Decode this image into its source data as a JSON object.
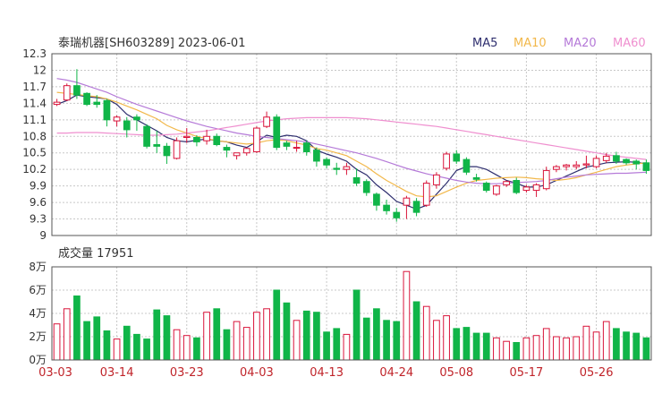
{
  "chart_data": {
    "type": "candlestick",
    "title": "泰瑞机器[SH603289] 2023-06-01",
    "legend": [
      {
        "label": "MA5",
        "color": "#2e2e6e"
      },
      {
        "label": "MA10",
        "color": "#f2b84b"
      },
      {
        "label": "MA20",
        "color": "#b57ad8"
      },
      {
        "label": "MA60",
        "color": "#ef8fcf"
      }
    ],
    "colors": {
      "up": "#d9143a",
      "down": "#10b548",
      "volume_up": "#d9143a",
      "volume_down": "#10b548"
    },
    "price_axis": {
      "ticks": [
        "12.3",
        "12",
        "11.7",
        "11.4",
        "11.1",
        "10.8",
        "10.5",
        "10.2",
        "9.9",
        "9.6",
        "9.3",
        "9"
      ],
      "ylim": [
        9,
        12.3
      ]
    },
    "x_labels": [
      "03-03",
      "03-14",
      "03-23",
      "04-03",
      "04-13",
      "04-24",
      "05-08",
      "05-17",
      "05-26"
    ],
    "x_label_index": [
      0,
      6,
      13,
      20,
      27,
      34,
      40,
      47,
      54
    ],
    "candles": [
      [
        11.38,
        11.48,
        11.35,
        11.42
      ],
      [
        11.46,
        11.76,
        11.44,
        11.72
      ],
      [
        11.72,
        12.02,
        11.48,
        11.55
      ],
      [
        11.58,
        11.6,
        11.35,
        11.38
      ],
      [
        11.42,
        11.55,
        11.32,
        11.38
      ],
      [
        11.45,
        11.48,
        10.98,
        11.1
      ],
      [
        11.08,
        11.18,
        10.98,
        11.15
      ],
      [
        11.08,
        11.15,
        10.78,
        10.92
      ],
      [
        11.15,
        11.2,
        10.9,
        11.1
      ],
      [
        10.98,
        11.02,
        10.58,
        10.62
      ],
      [
        10.65,
        10.9,
        10.5,
        10.62
      ],
      [
        10.62,
        10.68,
        10.3,
        10.45
      ],
      [
        10.4,
        10.78,
        10.38,
        10.72
      ],
      [
        10.78,
        10.95,
        10.68,
        10.8
      ],
      [
        10.78,
        10.82,
        10.62,
        10.7
      ],
      [
        10.72,
        10.92,
        10.65,
        10.8
      ],
      [
        10.8,
        10.85,
        10.62,
        10.65
      ],
      [
        10.6,
        10.65,
        10.42,
        10.55
      ],
      [
        10.45,
        10.5,
        10.38,
        10.5
      ],
      [
        10.5,
        10.6,
        10.45,
        10.58
      ],
      [
        10.52,
        10.98,
        10.5,
        10.95
      ],
      [
        10.98,
        11.25,
        10.95,
        11.15
      ],
      [
        11.15,
        11.2,
        10.55,
        10.6
      ],
      [
        10.68,
        10.72,
        10.55,
        10.62
      ],
      [
        10.6,
        10.72,
        10.52,
        10.6
      ],
      [
        10.68,
        10.72,
        10.45,
        10.52
      ],
      [
        10.55,
        10.6,
        10.25,
        10.35
      ],
      [
        10.38,
        10.42,
        10.22,
        10.28
      ],
      [
        10.22,
        10.32,
        10.1,
        10.2
      ],
      [
        10.2,
        10.32,
        10.1,
        10.25
      ],
      [
        10.05,
        10.22,
        9.9,
        9.95
      ],
      [
        9.98,
        10.02,
        9.72,
        9.78
      ],
      [
        9.75,
        9.78,
        9.45,
        9.55
      ],
      [
        9.55,
        9.65,
        9.38,
        9.45
      ],
      [
        9.42,
        9.5,
        9.25,
        9.32
      ],
      [
        9.55,
        9.72,
        9.3,
        9.68
      ],
      [
        9.62,
        9.68,
        9.35,
        9.42
      ],
      [
        9.55,
        10.0,
        9.52,
        9.95
      ],
      [
        9.92,
        10.15,
        9.85,
        10.1
      ],
      [
        10.22,
        10.52,
        10.18,
        10.48
      ],
      [
        10.48,
        10.55,
        10.3,
        10.35
      ],
      [
        10.38,
        10.42,
        10.1,
        10.15
      ],
      [
        10.05,
        10.12,
        9.98,
        10.02
      ],
      [
        9.95,
        9.98,
        9.78,
        9.82
      ],
      [
        9.75,
        9.92,
        9.72,
        9.9
      ],
      [
        9.92,
        10.0,
        9.88,
        9.98
      ],
      [
        10.0,
        10.05,
        9.75,
        9.78
      ],
      [
        9.82,
        9.92,
        9.78,
        9.88
      ],
      [
        9.82,
        9.95,
        9.7,
        9.92
      ],
      [
        9.85,
        10.25,
        9.82,
        10.18
      ],
      [
        10.2,
        10.28,
        10.15,
        10.25
      ],
      [
        10.25,
        10.3,
        10.18,
        10.28
      ],
      [
        10.25,
        10.35,
        10.2,
        10.28
      ],
      [
        10.28,
        10.45,
        10.22,
        10.3
      ],
      [
        10.25,
        10.45,
        10.22,
        10.4
      ],
      [
        10.36,
        10.5,
        10.32,
        10.44
      ],
      [
        10.45,
        10.52,
        10.3,
        10.35
      ],
      [
        10.38,
        10.4,
        10.28,
        10.32
      ],
      [
        10.35,
        10.38,
        10.2,
        10.3
      ],
      [
        10.32,
        10.38,
        10.12,
        10.18
      ]
    ],
    "moving_averages": [
      {
        "name": "MA5",
        "values": [
          11.38,
          11.45,
          11.55,
          11.52,
          11.5,
          11.48,
          11.38,
          11.2,
          11.1,
          11.0,
          10.9,
          10.78,
          10.72,
          10.7,
          10.73,
          10.75,
          10.72,
          10.7,
          10.64,
          10.6,
          10.7,
          10.82,
          10.78,
          10.82,
          10.8,
          10.72,
          10.55,
          10.48,
          10.42,
          10.35,
          10.2,
          10.1,
          9.92,
          9.78,
          9.62,
          9.55,
          9.48,
          9.55,
          9.75,
          9.95,
          10.18,
          10.25,
          10.25,
          10.2,
          10.1,
          10.0,
          9.95,
          9.88,
          9.88,
          9.92,
          10.0,
          10.08,
          10.16,
          10.24,
          10.28,
          10.32,
          10.33,
          10.34,
          10.33,
          10.3
        ]
      },
      {
        "name": "MA10",
        "values": [
          11.6,
          11.58,
          11.56,
          11.54,
          11.52,
          11.48,
          11.42,
          11.35,
          11.28,
          11.2,
          11.12,
          11.0,
          10.92,
          10.86,
          10.8,
          10.76,
          10.72,
          10.7,
          10.68,
          10.66,
          10.68,
          10.72,
          10.74,
          10.72,
          10.68,
          10.64,
          10.58,
          10.55,
          10.5,
          10.45,
          10.35,
          10.25,
          10.12,
          10.0,
          9.9,
          9.8,
          9.72,
          9.7,
          9.72,
          9.8,
          9.88,
          9.95,
          10.0,
          10.02,
          10.04,
          10.05,
          10.06,
          10.05,
          10.03,
          10.02,
          10.0,
          10.02,
          10.05,
          10.1,
          10.15,
          10.2,
          10.25,
          10.28,
          10.3,
          10.32
        ]
      },
      {
        "name": "MA20",
        "values": [
          11.85,
          11.82,
          11.78,
          11.72,
          11.66,
          11.6,
          11.52,
          11.45,
          11.38,
          11.32,
          11.26,
          11.2,
          11.14,
          11.08,
          11.03,
          10.98,
          10.94,
          10.9,
          10.86,
          10.83,
          10.8,
          10.78,
          10.76,
          10.74,
          10.72,
          10.7,
          10.66,
          10.62,
          10.58,
          10.54,
          10.5,
          10.45,
          10.4,
          10.34,
          10.28,
          10.22,
          10.17,
          10.12,
          10.08,
          10.04,
          10.0,
          9.97,
          9.95,
          9.94,
          9.94,
          9.95,
          9.96,
          9.97,
          9.98,
          10.0,
          10.03,
          10.06,
          10.08,
          10.1,
          10.11,
          10.12,
          10.13,
          10.13,
          10.14,
          10.15
        ]
      },
      {
        "name": "MA60",
        "values": [
          10.86,
          10.86,
          10.87,
          10.87,
          10.87,
          10.86,
          10.85,
          10.84,
          10.83,
          10.82,
          10.82,
          10.83,
          10.84,
          10.86,
          10.88,
          10.9,
          10.93,
          10.96,
          10.99,
          11.02,
          11.05,
          11.08,
          11.1,
          11.12,
          11.13,
          11.14,
          11.14,
          11.14,
          11.14,
          11.14,
          11.13,
          11.12,
          11.1,
          11.08,
          11.06,
          11.04,
          11.02,
          11.0,
          10.98,
          10.95,
          10.92,
          10.89,
          10.86,
          10.83,
          10.8,
          10.77,
          10.74,
          10.71,
          10.68,
          10.65,
          10.62,
          10.59,
          10.56,
          10.53,
          10.5,
          10.47,
          10.44,
          10.42,
          10.4,
          10.38
        ]
      }
    ],
    "volume": {
      "label": "成交量 17951",
      "unit_ticks": [
        "8万",
        "6万",
        "4万",
        "2万",
        "0万"
      ],
      "ylim": [
        0,
        80000
      ],
      "values": [
        31000,
        44000,
        55000,
        33000,
        37000,
        25000,
        18000,
        29000,
        22000,
        18000,
        43000,
        38000,
        26000,
        21000,
        19000,
        41000,
        44000,
        26000,
        33000,
        28000,
        41000,
        44000,
        60000,
        49000,
        34000,
        42000,
        41000,
        24000,
        27000,
        22000,
        60000,
        36000,
        44000,
        34000,
        33000,
        76000,
        50000,
        46000,
        34000,
        38000,
        27000,
        28000,
        23000,
        23000,
        19000,
        16000,
        15000,
        19000,
        21000,
        27000,
        20000,
        19000,
        20000,
        29000,
        24000,
        33000,
        27000,
        24000,
        23000,
        19000
      ]
    }
  }
}
